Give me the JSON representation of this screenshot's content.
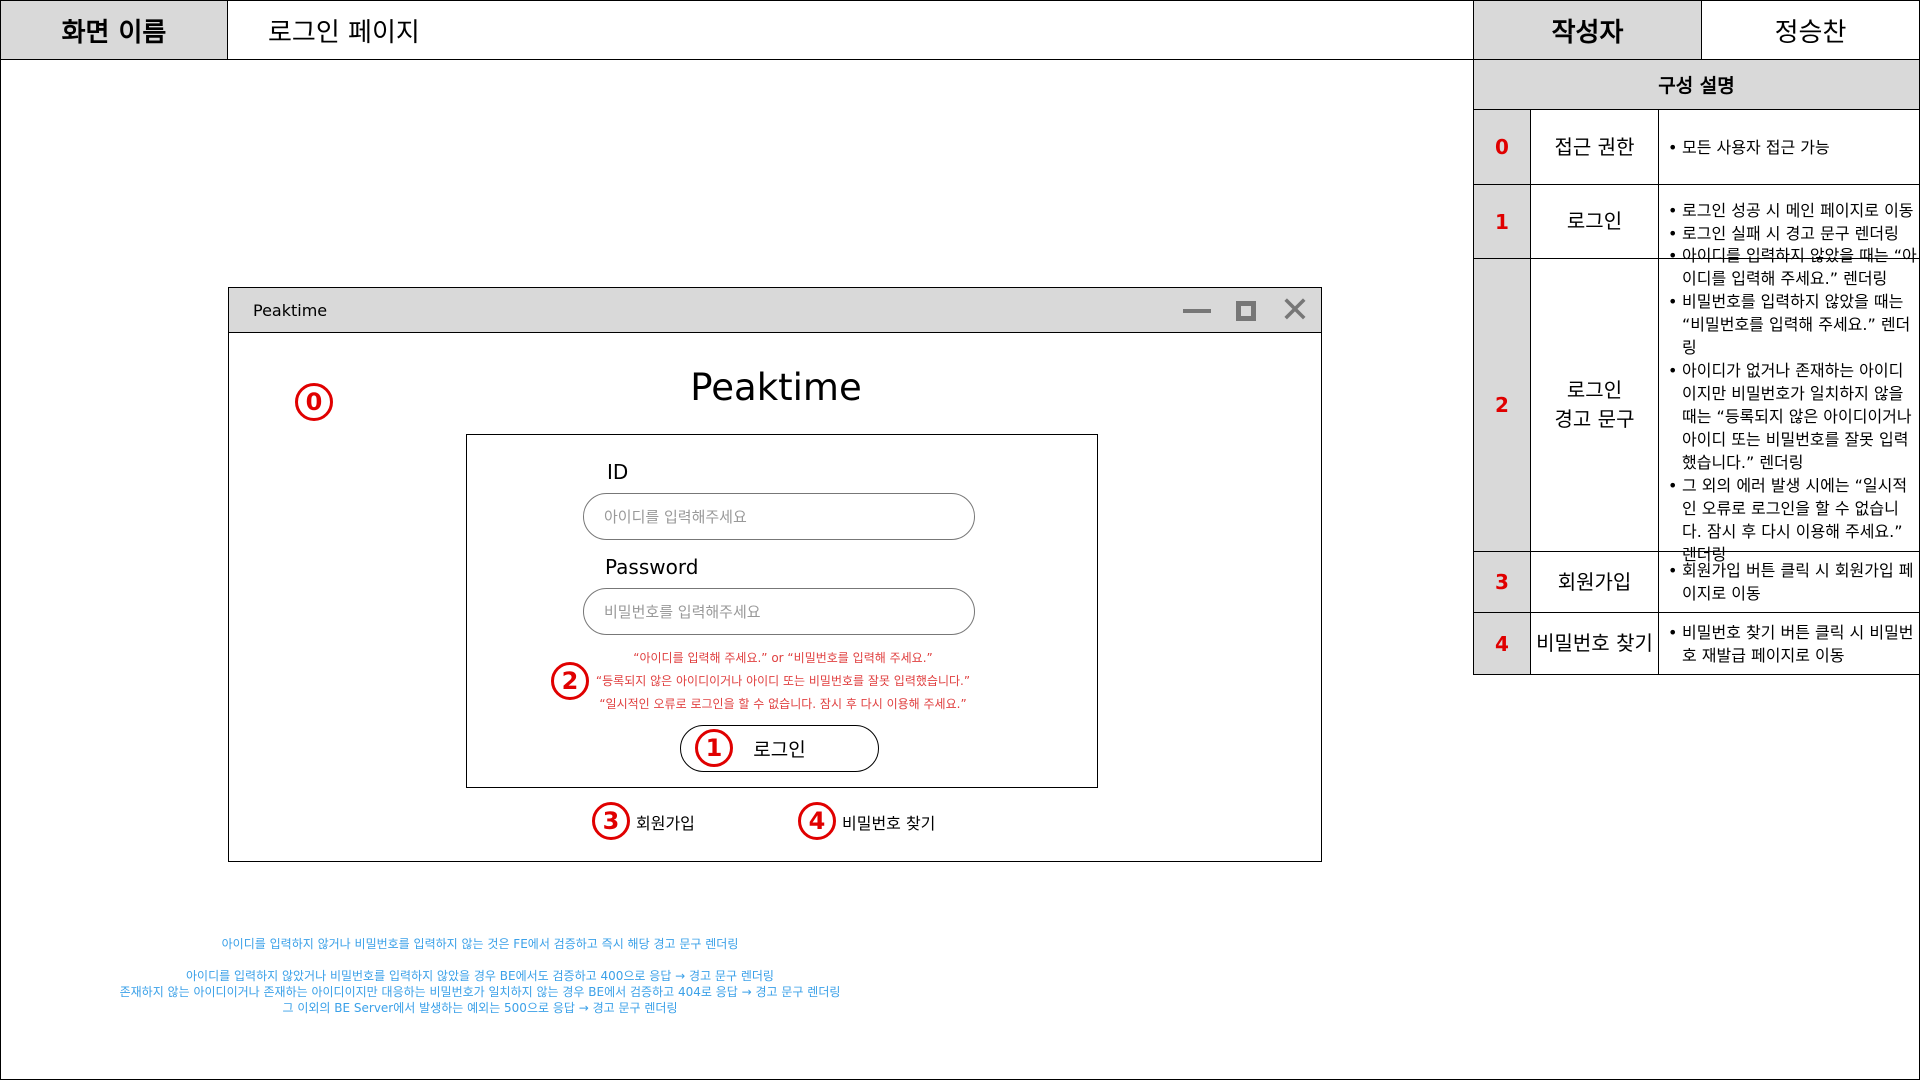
{
  "header": {
    "screen_name_label": "화면 이름",
    "screen_name_value": "로그인 페이지",
    "author_label": "작성자",
    "author_value": "정승찬"
  },
  "description": {
    "heading": "구성 설명",
    "rows": [
      {
        "num": "0",
        "name": "접근 권한",
        "items": [
          "모든 사용자 접근 가능"
        ]
      },
      {
        "num": "1",
        "name": "로그인",
        "items": [
          "로그인 성공 시 메인 페이지로 이동",
          "로그인 실패 시 경고 문구 렌더링"
        ]
      },
      {
        "num": "2",
        "name_lines": [
          "로그인",
          "경고 문구"
        ],
        "items": [
          "아이디를 입력하지 않았을 때는 “아이디를 입력해 주세요.” 렌더링",
          "비밀번호를 입력하지 않았을 때는 “비밀번호를 입력해 주세요.” 렌더링",
          "아이디가 없거나 존재하는 아이디이지만 비밀번호가 일치하지 않을 때는 “등록되지 않은 아이디이거나 아이디 또는 비밀번호를 잘못 입력했습니다.” 렌더링",
          "그 외의 에러 발생 시에는 “일시적인 오류로 로그인을 할 수 없습니다. 잠시 후 다시 이용해 주세요.” 렌더링"
        ]
      },
      {
        "num": "3",
        "name": "회원가입",
        "items": [
          "회원가입 버튼 클릭 시 회원가입 페이지로 이동"
        ]
      },
      {
        "num": "4",
        "name": "비밀번호 찾기",
        "items": [
          "비밀번호 찾기 버튼 클릭 시 비밀번호 재발급 페이지로 이동"
        ]
      }
    ]
  },
  "window": {
    "title": "Peaktime",
    "minimize_icon": "minimize-icon",
    "maximize_icon": "maximize-icon",
    "close_icon": "close-icon",
    "close_glyph": "✕"
  },
  "login": {
    "app_title": "Peaktime",
    "id_label": "ID",
    "id_placeholder": "아이디를 입력해주세요",
    "password_label": "Password",
    "password_placeholder": "비밀번호를 입력해주세요",
    "errors": [
      "“아이디를 입력해 주세요.” or “비밀번호를 입력해 주세요.”",
      "“등록되지 않은 아이디이거나 아이디 또는 비밀번호를 잘못 입력했습니다.”",
      "“일시적인 오류로 로그인을 할 수 없습니다. 잠시 후 다시 이용해 주세요.”"
    ],
    "login_button": "로그인",
    "signup_link": "회원가입",
    "find_password_link": "비밀번호 찾기"
  },
  "markers": {
    "m0": "0",
    "m1": "1",
    "m2": "2",
    "m3": "3",
    "m4": "4"
  },
  "notes": {
    "line1": "아이디를 입력하지 않거나 비밀번호를 입력하지 않는 것은 FE에서 검증하고 즉시 해당 경고 문구 렌더링",
    "line2": "아이디를 입력하지 않았거나 비밀번호를 입력하지 않았을 경우 BE에서도 검증하고 400으로 응답 → 경고 문구 렌더링",
    "line3": "존재하지 않는 아이디이거나 존재하는 아이디이지만 대응하는 비밀번호가 일치하지 않는 경우 BE에서 검증하고 404로 응답 → 경고 문구 렌더링",
    "line4": "그 이외의 BE Server에서 발생하는 예외는 500으로 응답 → 경고 문구 렌더링"
  },
  "colors": {
    "marker_red": "#e00000",
    "note_blue": "#3aa0e8",
    "header_gray": "#d9d9d9",
    "error_red": "#e04040"
  }
}
